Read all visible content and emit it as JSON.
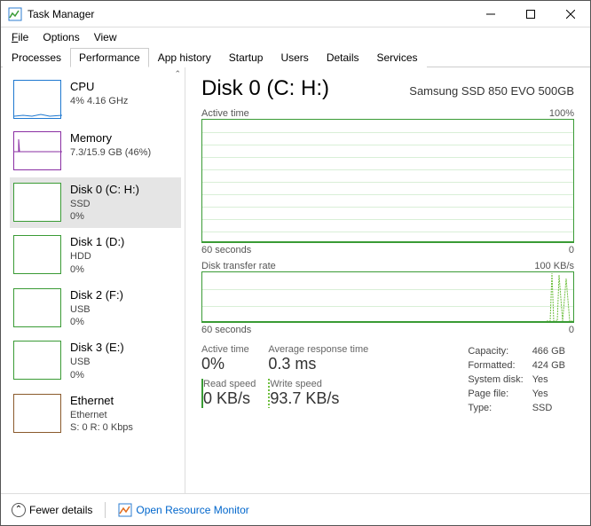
{
  "window": {
    "title": "Task Manager"
  },
  "menu": {
    "file": "File",
    "options": "Options",
    "view": "View"
  },
  "tabs": [
    "Processes",
    "Performance",
    "App history",
    "Startup",
    "Users",
    "Details",
    "Services"
  ],
  "activeTab": "Performance",
  "sidebar": [
    {
      "name": "CPU",
      "sub1": "4% 4.16 GHz",
      "sub2": "",
      "color": "cpu"
    },
    {
      "name": "Memory",
      "sub1": "7.3/15.9 GB (46%)",
      "sub2": "",
      "color": "mem"
    },
    {
      "name": "Disk 0 (C: H:)",
      "sub1": "SSD",
      "sub2": "0%",
      "color": "disk",
      "selected": true
    },
    {
      "name": "Disk 1 (D:)",
      "sub1": "HDD",
      "sub2": "0%",
      "color": "disk"
    },
    {
      "name": "Disk 2 (F:)",
      "sub1": "USB",
      "sub2": "0%",
      "color": "disk"
    },
    {
      "name": "Disk 3 (E:)",
      "sub1": "USB",
      "sub2": "0%",
      "color": "disk"
    },
    {
      "name": "Ethernet",
      "sub1": "Ethernet",
      "sub2": "S: 0 R: 0 Kbps",
      "color": "net"
    }
  ],
  "detail": {
    "title": "Disk 0 (C: H:)",
    "subtitle": "Samsung SSD 850 EVO 500GB",
    "chart1": {
      "label": "Active time",
      "max": "100%",
      "xlabel": "60 seconds",
      "xright": "0"
    },
    "chart2": {
      "label": "Disk transfer rate",
      "max": "100 KB/s",
      "xlabel": "60 seconds",
      "xright": "0"
    },
    "stats": {
      "active_lbl": "Active time",
      "active_val": "0%",
      "resp_lbl": "Average response time",
      "resp_val": "0.3 ms",
      "read_lbl": "Read speed",
      "read_val": "0 KB/s",
      "write_lbl": "Write speed",
      "write_val": "93.7 KB/s"
    },
    "kv": [
      [
        "Capacity:",
        "466 GB"
      ],
      [
        "Formatted:",
        "424 GB"
      ],
      [
        "System disk:",
        "Yes"
      ],
      [
        "Page file:",
        "Yes"
      ],
      [
        "Type:",
        "SSD"
      ]
    ]
  },
  "footer": {
    "fewer": "Fewer details",
    "monitor": "Open Resource Monitor"
  },
  "chart_data": {
    "type": "line",
    "title": "Disk 0 Active time / Transfer rate",
    "series": [
      {
        "name": "Active time (%)",
        "ylim": [
          0,
          100
        ],
        "values_approx": "flat ~0% over 60s"
      },
      {
        "name": "Read (KB/s)",
        "ylim": [
          0,
          100
        ],
        "values_approx": "flat ~0 over 60s"
      },
      {
        "name": "Write (KB/s)",
        "ylim": [
          0,
          100
        ],
        "values_approx": "mostly 0, spikes near 100 KB/s at rightmost few seconds"
      }
    ],
    "xspan_seconds": 60
  }
}
